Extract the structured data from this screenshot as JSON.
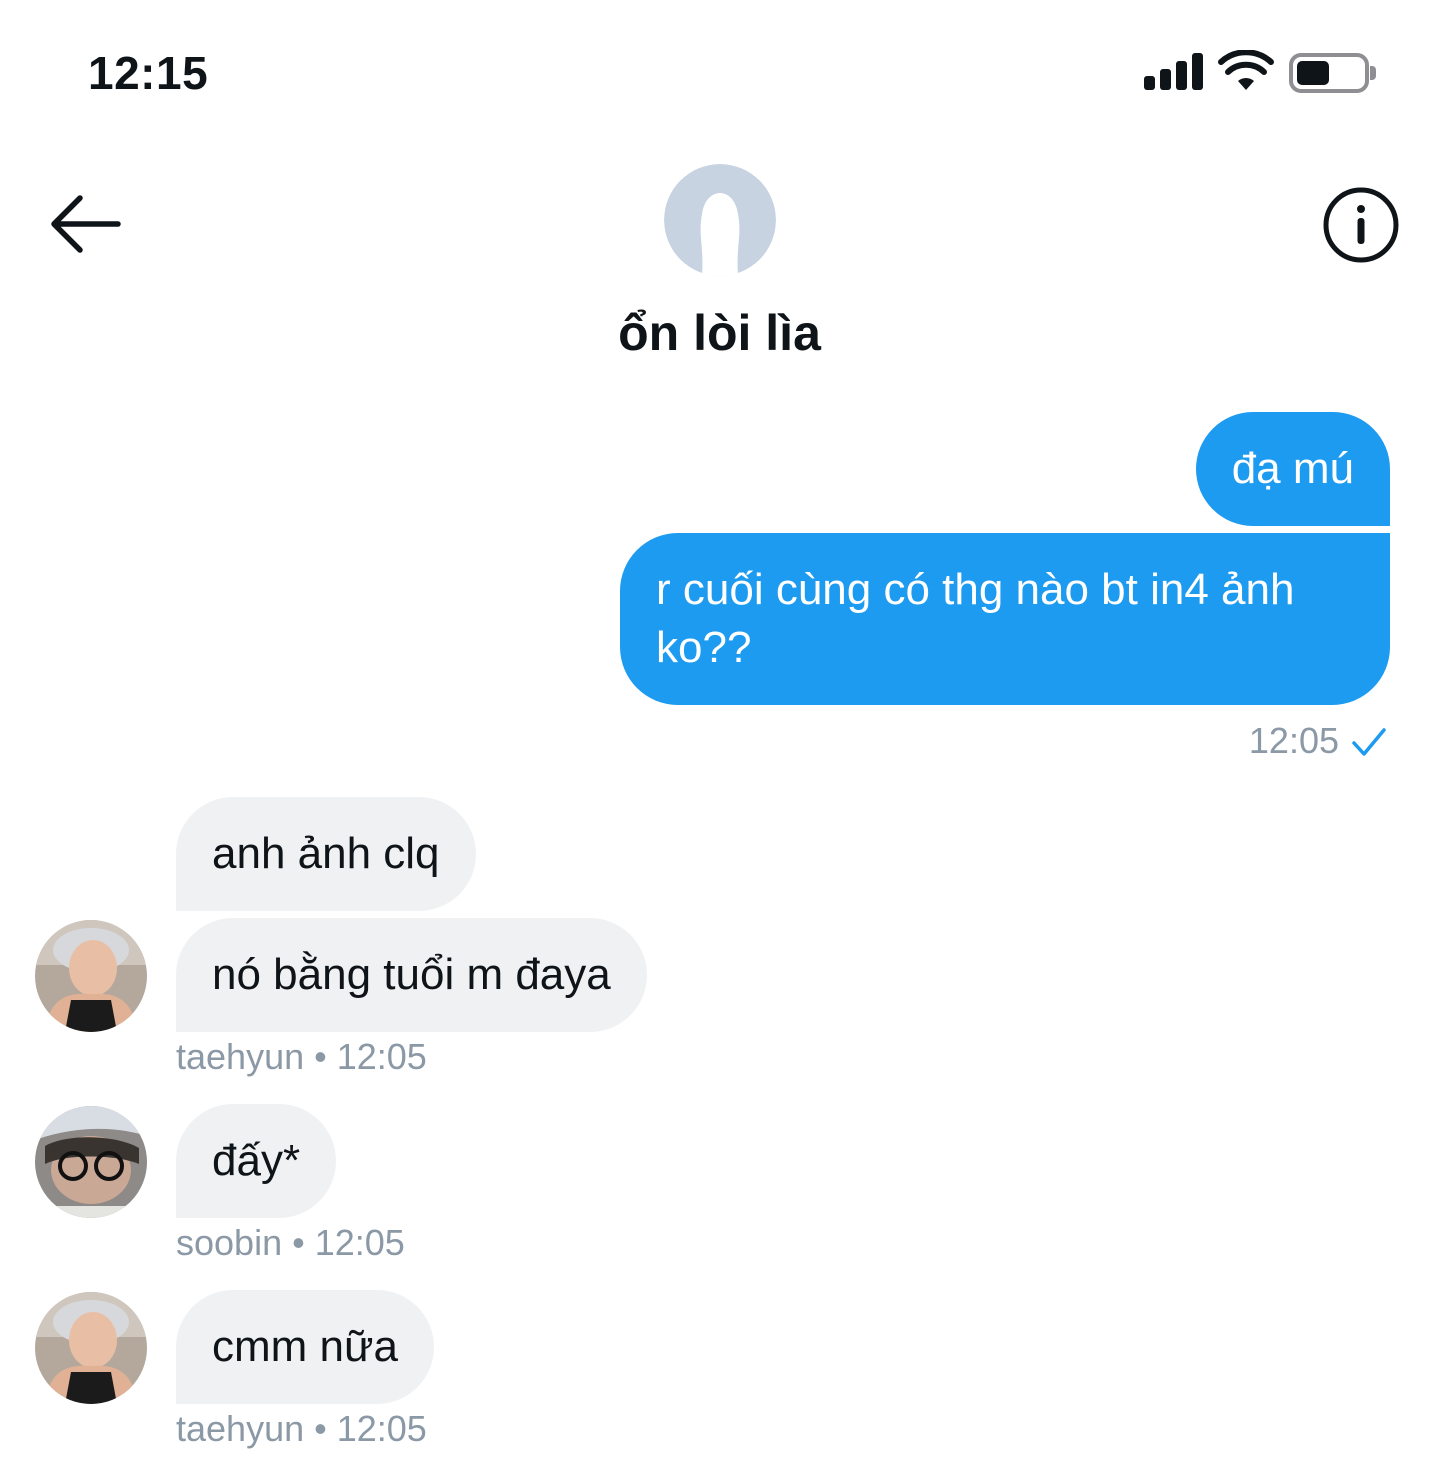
{
  "status_bar": {
    "time": "12:15"
  },
  "header": {
    "title": "ổn lòi lìa",
    "back_icon": "arrow-left-icon",
    "info_icon": "info-icon"
  },
  "messages": {
    "outgoing": [
      {
        "text": "đạ mú"
      },
      {
        "text": "r cuối cùng có thg nào bt in4 ảnh ko??"
      }
    ],
    "outgoing_time": "12:05",
    "incoming": [
      {
        "text": "anh ảnh clq"
      },
      {
        "text": "nó bằng tuổi m đaya",
        "meta": "taehyun • 12:05"
      },
      {
        "text": "đấy*",
        "meta": "soobin • 12:05"
      },
      {
        "text": "cmm nữa",
        "meta": "taehyun • 12:05"
      }
    ]
  },
  "colors": {
    "accent": "#1d9bf0",
    "incoming_bubble": "#eff1f3",
    "meta_text": "#8b98a5"
  }
}
